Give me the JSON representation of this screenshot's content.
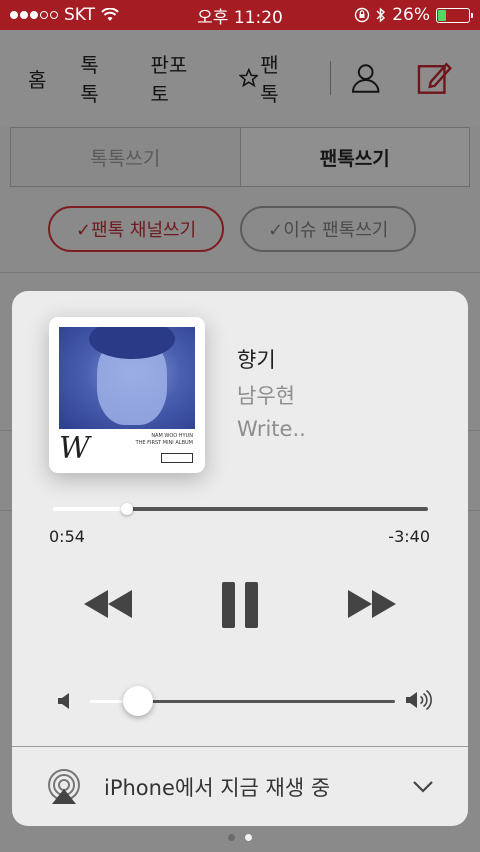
{
  "status_bar": {
    "carrier": "SKT",
    "time": "오후 11:20",
    "battery_percent": "26%",
    "battery_level": 0.26,
    "battery_color": "#4cd964",
    "signal_filled": 3,
    "signal_total": 5
  },
  "app": {
    "nav": [
      "홈",
      "톡톡",
      "판포토",
      "팬톡"
    ],
    "write_tabs": [
      {
        "label": "톡톡쓰기",
        "active": false
      },
      {
        "label": "팬톡쓰기",
        "active": true
      }
    ],
    "pills": [
      {
        "label": "✓팬톡 채널쓰기",
        "style": "red"
      },
      {
        "label": "✓이슈 팬톡쓰기",
        "style": "gray"
      }
    ],
    "brand_color": "#a51c22",
    "page_dots": {
      "count": 2,
      "active_index": 1
    }
  },
  "now_playing": {
    "title": "향기",
    "artist": "남우현",
    "album": "Write..",
    "album_art": {
      "letter": "W",
      "small_text_1": "NAM WOO HYUN",
      "small_text_2": "THE FIRST MINI ALBUM"
    },
    "elapsed": "0:54",
    "remaining": "-3:40",
    "progress": 0.2,
    "volume": 0.16,
    "controls": [
      "rewind-icon",
      "pause-icon",
      "fast-forward-icon"
    ],
    "airplay_label": "iPhone에서 지금 재생 중"
  }
}
